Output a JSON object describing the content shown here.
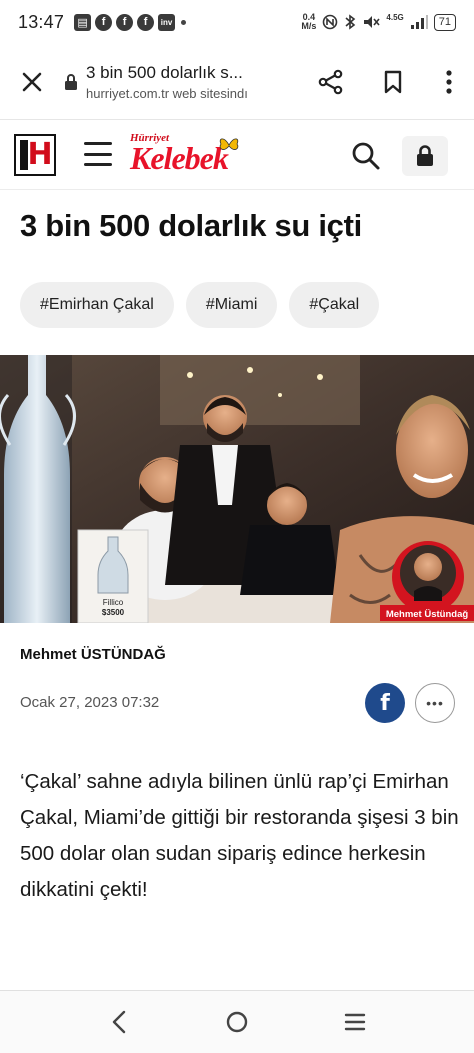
{
  "status_bar": {
    "time": "13:47",
    "net_speed_value": "0.4",
    "net_speed_unit": "M/s",
    "network_label": "4.5G",
    "battery": "71",
    "left_icons": [
      "gallery-icon",
      "facebook-icon",
      "facebook-icon",
      "facebook-icon",
      "inv-icon"
    ]
  },
  "browser": {
    "page_title": "3 bin 500 dolarlık s...",
    "url_line": "hurriyet.com.tr web sitesindı"
  },
  "site_header": {
    "logo_letter": "H",
    "brand_small": "Hürriyet",
    "brand_main": "Kelebek"
  },
  "article": {
    "headline": "3 bin 500 dolarlık su içti",
    "tags": [
      "#Emirhan Çakal",
      "#Miami",
      "#Çakal"
    ],
    "image_caption_name": "Mehmet Üstündağ",
    "bottle_label_brand": "Fillico",
    "bottle_label_price": "$3500",
    "author": "Mehmet ÜSTÜNDAĞ",
    "date": "Ocak 27, 2023 07:32",
    "share_fb_label": "f",
    "share_more_label": "•••",
    "body": "‘Çakal’ sahne adıyla bilinen ünlü rap’çi Emirhan Çakal, Miami’de gittiği bir restoranda şişesi 3 bin 500 dolar olan sudan sipariş edince herkesin dikkatini çekti!"
  },
  "colors": {
    "brand_red": "#e8132a",
    "facebook_blue": "#1f4a8c",
    "tag_bg": "#efefef"
  },
  "bottom_nav": [
    "back-icon",
    "home-icon",
    "recents-icon"
  ]
}
